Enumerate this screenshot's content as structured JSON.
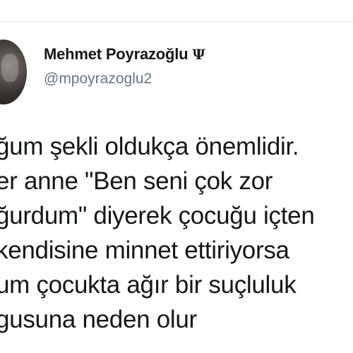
{
  "author": {
    "display_name": "Mehmet Poyrazoğlu",
    "badge_icon": "psi-icon",
    "badge_glyph": "Ψ",
    "handle": "@mpoyrazoglu2",
    "avatar_icon": "profile-photo"
  },
  "tweet": {
    "lines": [
      "ğum şekli oldukça önemlidir.",
      "er anne \"Ben seni çok zor",
      "ğurdum\" diyerek çocuğu içten",
      "kendisine minnet ettiriyorsa",
      "um çocukta ağır bir suçluluk",
      "gusuna neden olur"
    ]
  },
  "colors": {
    "name_text": "#14171a",
    "handle_text": "#657786",
    "divider": "#e6ecf0",
    "background": "#ffffff"
  }
}
